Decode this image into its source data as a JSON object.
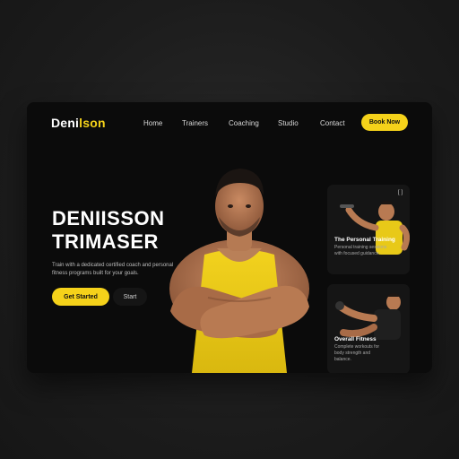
{
  "brand": {
    "name_main": "Deni",
    "name_accent": "lson"
  },
  "nav": {
    "links": [
      "Home",
      "Trainers",
      "Coaching",
      "Studio",
      "Contact"
    ],
    "cta_label": "Book Now"
  },
  "hero": {
    "title_line1": "DENIISSON",
    "title_line2": "TRIMASER",
    "description": "Train with a dedicated certified coach and personal fitness programs built for your goals.",
    "primary_button": "Get Started",
    "secondary_button": "Start"
  },
  "cards": [
    {
      "title": "The Personal Training",
      "description": "Personal training sessions with focused guidance.",
      "badge": "[ ]"
    },
    {
      "title": "Overall Fitness",
      "description": "Complete workouts for body strength and balance."
    }
  ],
  "colors": {
    "accent": "#f5d21a",
    "background": "#0b0b0b",
    "page": "#1e1e1e"
  }
}
